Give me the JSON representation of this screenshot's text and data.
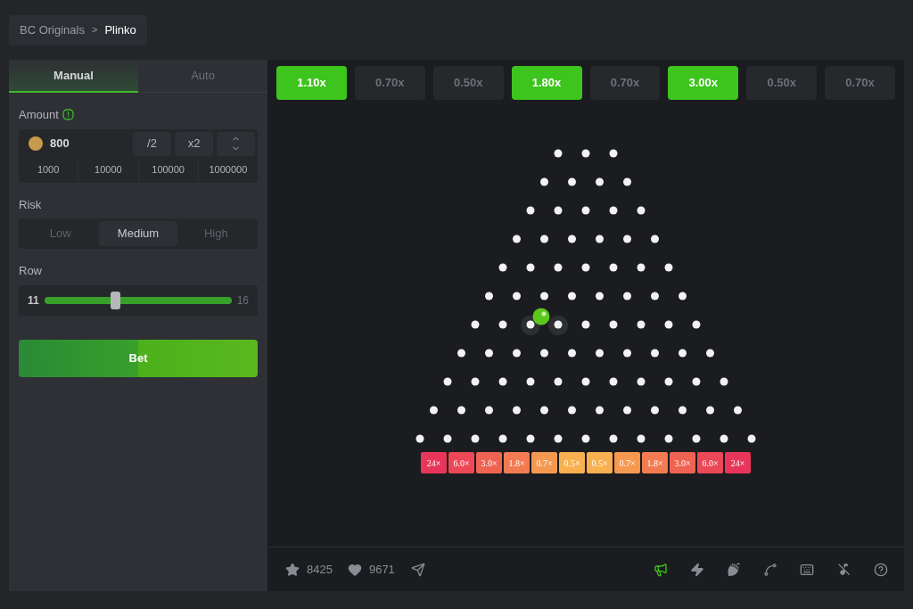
{
  "breadcrumb": {
    "parent": "BC Originals",
    "separator": ">",
    "current": "Plinko"
  },
  "tabs": [
    {
      "label": "Manual",
      "selected": true
    },
    {
      "label": "Auto",
      "selected": false
    }
  ],
  "amount": {
    "label": "Amount",
    "value": "800",
    "buttons": [
      "/2",
      "x2"
    ],
    "presets": [
      "1000",
      "10000",
      "100000",
      "1000000"
    ]
  },
  "risk": {
    "label": "Risk",
    "options": [
      {
        "label": "Low",
        "selected": false
      },
      {
        "label": "Medium",
        "selected": true
      },
      {
        "label": "High",
        "selected": false
      }
    ]
  },
  "row": {
    "label": "Row",
    "min": "11",
    "max": "16",
    "level": 0.38
  },
  "bet_button": "Bet",
  "recent_results": [
    {
      "label": "1.10x",
      "win": true
    },
    {
      "label": "0.70x",
      "win": false
    },
    {
      "label": "0.50x",
      "win": false
    },
    {
      "label": "1.80x",
      "win": true
    },
    {
      "label": "0.70x",
      "win": false
    },
    {
      "label": "3.00x",
      "win": true
    },
    {
      "label": "0.50x",
      "win": false
    },
    {
      "label": "0.70x",
      "win": false
    }
  ],
  "buckets": [
    {
      "label": "24×",
      "color": "#e8365a"
    },
    {
      "label": "6.0×",
      "color": "#ec4858"
    },
    {
      "label": "3.0×",
      "color": "#ef6352"
    },
    {
      "label": "1.8×",
      "color": "#f27b52"
    },
    {
      "label": "0.7×",
      "color": "#f59850"
    },
    {
      "label": "0.5×",
      "color": "#f8b050"
    },
    {
      "label": "0.5×",
      "color": "#f8b050"
    },
    {
      "label": "0.7×",
      "color": "#f59850"
    },
    {
      "label": "1.8×",
      "color": "#f27b52"
    },
    {
      "label": "3.0×",
      "color": "#ef6352"
    },
    {
      "label": "6.0×",
      "color": "#ec4858"
    },
    {
      "label": "24×",
      "color": "#e8365a"
    }
  ],
  "footer": {
    "stars": "8425",
    "likes": "9671",
    "tools": [
      {
        "kind": "sound",
        "on": true
      },
      {
        "kind": "fast",
        "on": false
      },
      {
        "kind": "hotkeys",
        "on": false
      },
      {
        "kind": "curve",
        "on": false
      },
      {
        "kind": "keyboard",
        "on": false
      },
      {
        "kind": "music",
        "on": false
      },
      {
        "kind": "help",
        "on": false
      }
    ]
  }
}
